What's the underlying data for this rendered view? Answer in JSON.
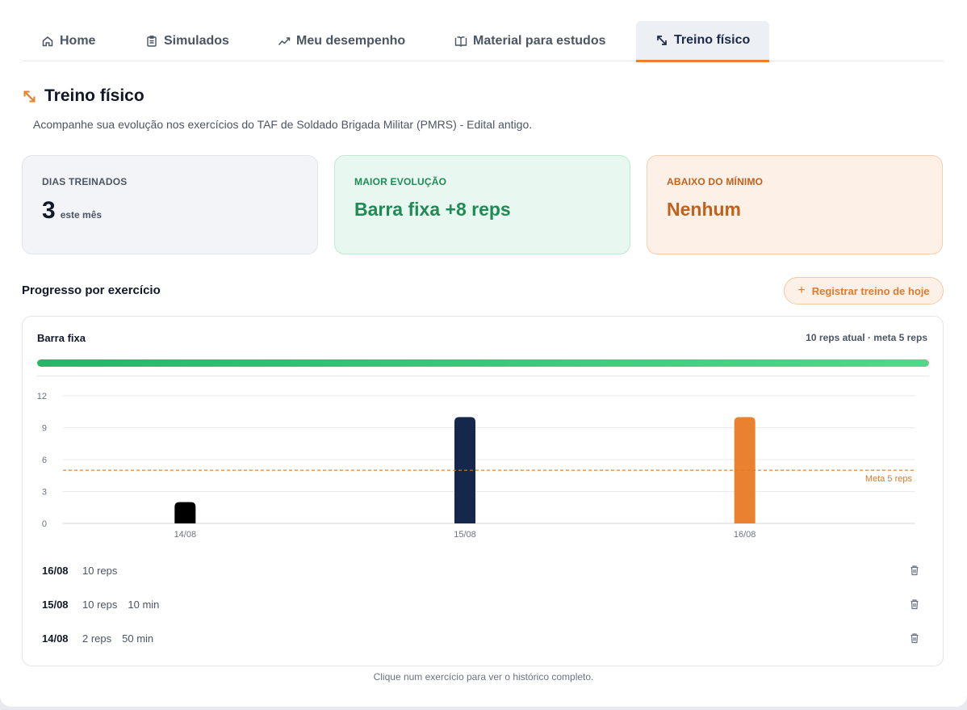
{
  "tabs": [
    {
      "label": "Home",
      "icon": "home-icon"
    },
    {
      "label": "Simulados",
      "icon": "clipboard-icon"
    },
    {
      "label": "Meu desempenho",
      "icon": "trend-icon"
    },
    {
      "label": "Material para estudos",
      "icon": "book-icon"
    },
    {
      "label": "Treino físico",
      "icon": "expand-arrows-icon",
      "active": true
    }
  ],
  "header": {
    "title": "Treino físico",
    "subtitle": "Acompanhe sua evolução nos exercícios do TAF de Soldado Brigada Militar (PMRS) - Edital antigo."
  },
  "cards": {
    "days": {
      "label": "Dias treinados",
      "value": "3",
      "unit": "este mês"
    },
    "best": {
      "label": "Maior evolução",
      "value": "Barra fixa +8 reps"
    },
    "below": {
      "label": "Abaixo do mínimo",
      "value": "Nenhum"
    }
  },
  "section": {
    "title": "Progresso por exercício",
    "register_label": "Registrar treino de hoje"
  },
  "exercise": {
    "name": "Barra fixa",
    "meta": "10 reps atual · meta 5 reps",
    "progress_fraction": 1.0
  },
  "chart_data": {
    "type": "bar",
    "categories": [
      "14/08",
      "15/08",
      "16/08"
    ],
    "values": [
      2,
      10,
      10
    ],
    "colors": [
      "#000000",
      "#14284b",
      "#e8822f"
    ],
    "yticks": [
      0,
      3,
      6,
      9,
      12
    ],
    "ylim": [
      0,
      12
    ],
    "goal": {
      "value": 5,
      "label": "Meta 5 reps",
      "color": "#d97a2b"
    },
    "grid": true
  },
  "history": [
    {
      "date": "16/08",
      "values": [
        "10 reps"
      ]
    },
    {
      "date": "15/08",
      "values": [
        "10 reps",
        "10 min"
      ]
    },
    {
      "date": "14/08",
      "values": [
        "2 reps",
        "50 min"
      ]
    }
  ],
  "footer": {
    "hint": "Clique num exercício para ver o histórico completo."
  },
  "colors": {
    "accent": "#e8822f",
    "navy": "#1b2a4a",
    "green": "#1f8a56"
  }
}
